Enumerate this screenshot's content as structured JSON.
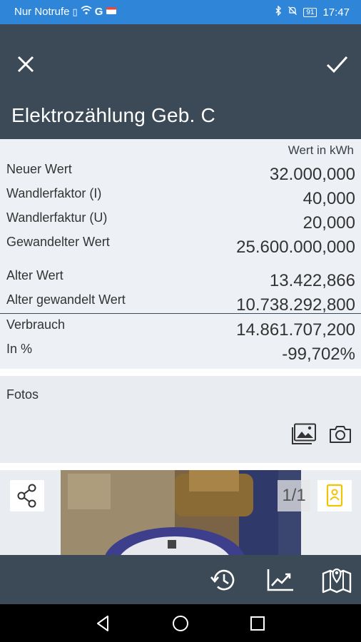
{
  "status_bar": {
    "carrier": "Nur Notrufe",
    "network_letter": "G",
    "battery": "91",
    "time": "17:47"
  },
  "app_bar": {
    "title": "Elektrozählung Geb. C"
  },
  "readings": {
    "unit_label": "Wert in kWh",
    "rows": [
      {
        "label": "Neuer Wert",
        "value": "32.000,000"
      },
      {
        "label": "Wandlerfaktor (I)",
        "value": "40,000"
      },
      {
        "label": "Wandlerfaktur (U)",
        "value": "20,000"
      },
      {
        "label": "Gewandelter Wert",
        "value": "25.600.000,000"
      },
      {
        "label": "Alter Wert",
        "value": "13.422,866"
      },
      {
        "label": "Alter gewandelt Wert",
        "value": "10.738.292,800"
      },
      {
        "label": "Verbrauch",
        "value": "14.861.707,200"
      },
      {
        "label": "In %",
        "value": "-99,702%"
      }
    ]
  },
  "photos": {
    "label": "Fotos",
    "counter": "1/1"
  },
  "colors": {
    "status_bar": "#2f86d9",
    "app_bar": "#3c4a57",
    "card_bg": "#edf1f5",
    "contact_icon": "#f2c300"
  },
  "icons": {
    "close": "close-icon",
    "confirm": "check-icon",
    "gallery": "image-gallery-icon",
    "camera": "camera-icon",
    "share": "share-icon",
    "contact": "contact-card-icon",
    "history": "history-icon",
    "chart": "trend-chart-icon",
    "map": "map-pin-icon",
    "nav_back": "back-triangle-icon",
    "nav_home": "home-circle-icon",
    "nav_recents": "recents-square-icon"
  }
}
